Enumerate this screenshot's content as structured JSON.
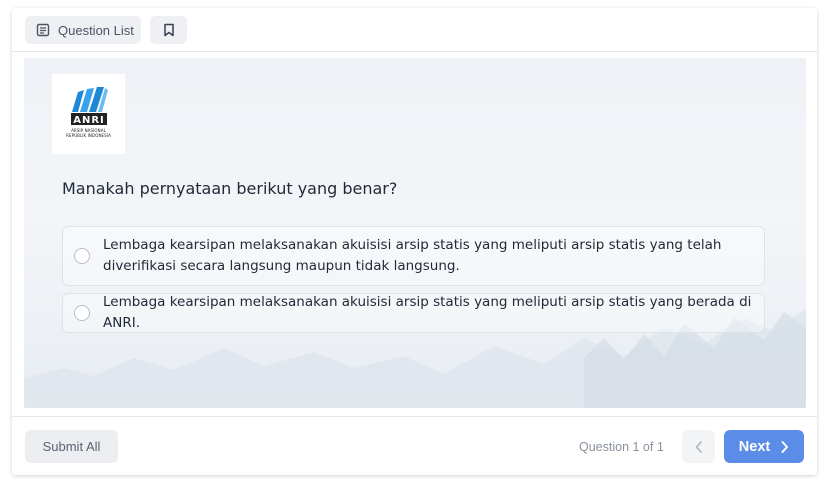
{
  "header": {
    "question_list_label": "Question List",
    "question_list_icon": "list-icon",
    "bookmark_icon": "bookmark-icon"
  },
  "logo": {
    "acronym": "ANRI",
    "line1": "ARSIP NASIONAL",
    "line2": "REPUBLIK INDONESIA"
  },
  "question": {
    "text": "Manakah pernyataan berikut yang benar?",
    "options": [
      {
        "text": "Lembaga kearsipan melaksanakan akuisisi arsip statis yang meliputi arsip statis yang telah diverifikasi secara langsung maupun tidak langsung.",
        "selected": false
      },
      {
        "text": "Lembaga kearsipan melaksanakan akuisisi arsip statis yang meliputi arsip statis yang berada di ANRI.",
        "selected": false
      }
    ]
  },
  "footer": {
    "submit_label": "Submit All",
    "question_counter": "Question 1 of 1",
    "next_label": "Next",
    "prev_icon": "chevron-left-icon",
    "next_icon": "chevron-right-icon"
  },
  "colors": {
    "accent": "#5b8de8",
    "logo_blue": "#1e88d6"
  }
}
